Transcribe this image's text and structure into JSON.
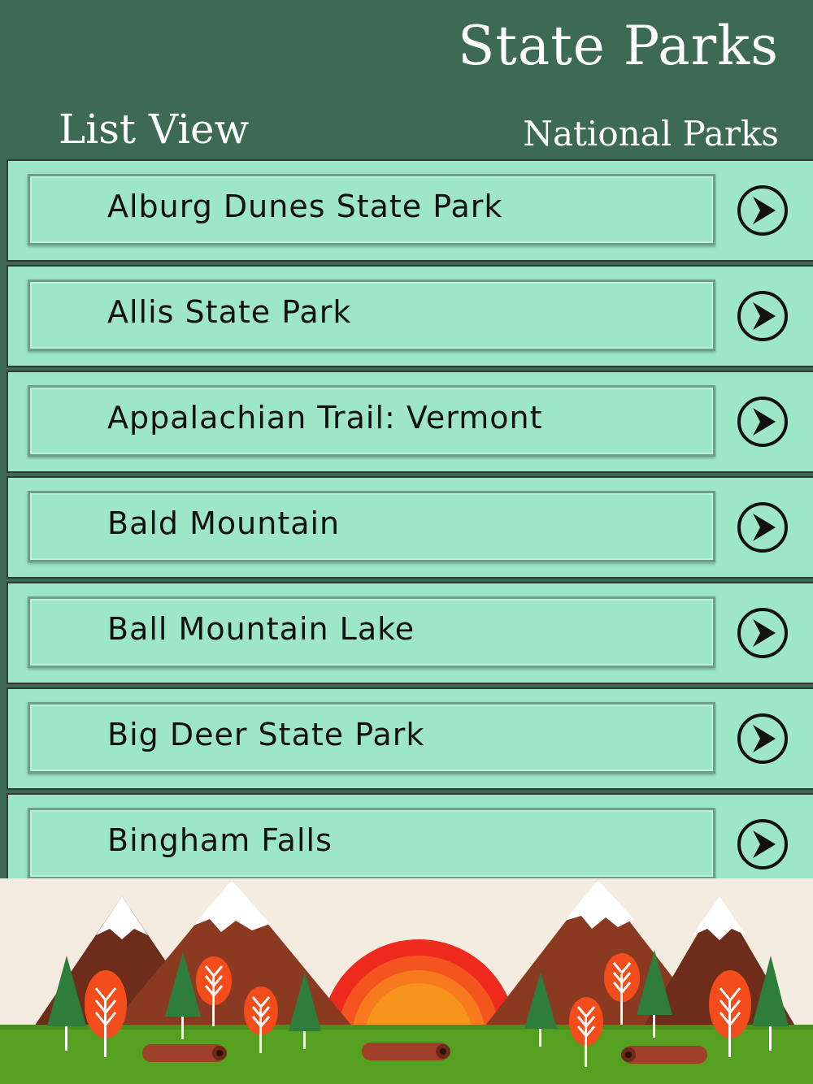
{
  "header": {
    "title": "State Parks",
    "tabs": [
      {
        "label": "List View",
        "active": true
      },
      {
        "label": "National Parks",
        "active": false
      }
    ]
  },
  "parks": [
    {
      "name": "Alburg Dunes State Park",
      "icon": "chevron-right-circle-icon"
    },
    {
      "name": "Allis State Park",
      "icon": "chevron-right-circle-icon"
    },
    {
      "name": "Appalachian Trail: Vermont",
      "icon": "chevron-right-circle-icon"
    },
    {
      "name": "Bald Mountain",
      "icon": "chevron-right-circle-icon"
    },
    {
      "name": "Ball Mountain Lake",
      "icon": "chevron-right-circle-icon"
    },
    {
      "name": "Big Deer State Park",
      "icon": "chevron-right-circle-icon"
    },
    {
      "name": "Bingham Falls",
      "icon": "chevron-right-circle-icon"
    }
  ],
  "colors": {
    "header": "#3c6a55",
    "row": "#9de6c8",
    "sky": "#f4ece0",
    "grass": "#55a020",
    "mountain": "#8b3a22",
    "sun_outer": "#ee2020",
    "sun_inner": "#f7941d"
  }
}
